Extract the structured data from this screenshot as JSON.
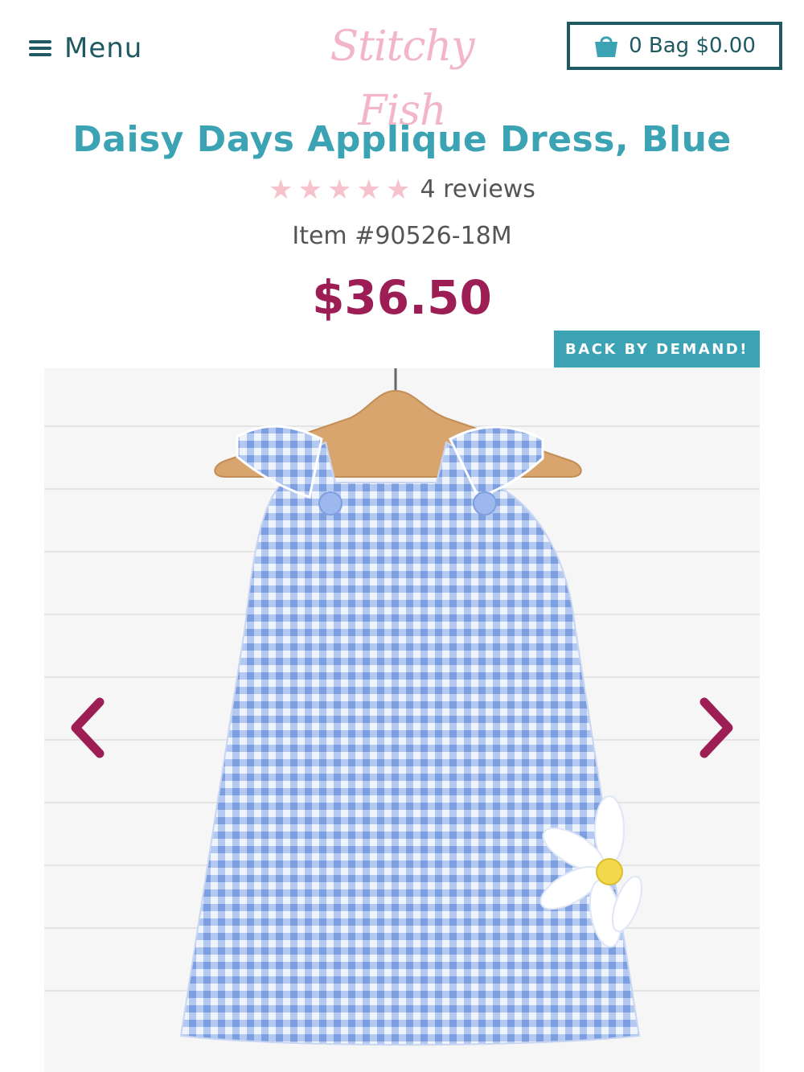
{
  "header": {
    "menu_label": "Menu",
    "logo_text": "Stitchy Fish",
    "bag_label": "0 Bag $0.00"
  },
  "product": {
    "title": "Daisy Days Applique Dress, Blue",
    "rating_stars": 5,
    "reviews_label": "4 reviews",
    "item_number": "Item #90526-18M",
    "price": "$36.50",
    "badge": "BACK BY DEMAND!"
  },
  "icons": {
    "menu": "hamburger-icon",
    "bag": "shopping-bag-icon",
    "star": "star-icon",
    "prev": "chevron-left-icon",
    "next": "chevron-right-icon"
  },
  "colors": {
    "brand_teal": "#3ba3b3",
    "dark_teal": "#1f5a62",
    "price_magenta": "#9c1e55",
    "logo_pink": "#f2b6c8",
    "star_pink": "#f6c2cc",
    "gingham_blue": "#8fb0e8"
  }
}
